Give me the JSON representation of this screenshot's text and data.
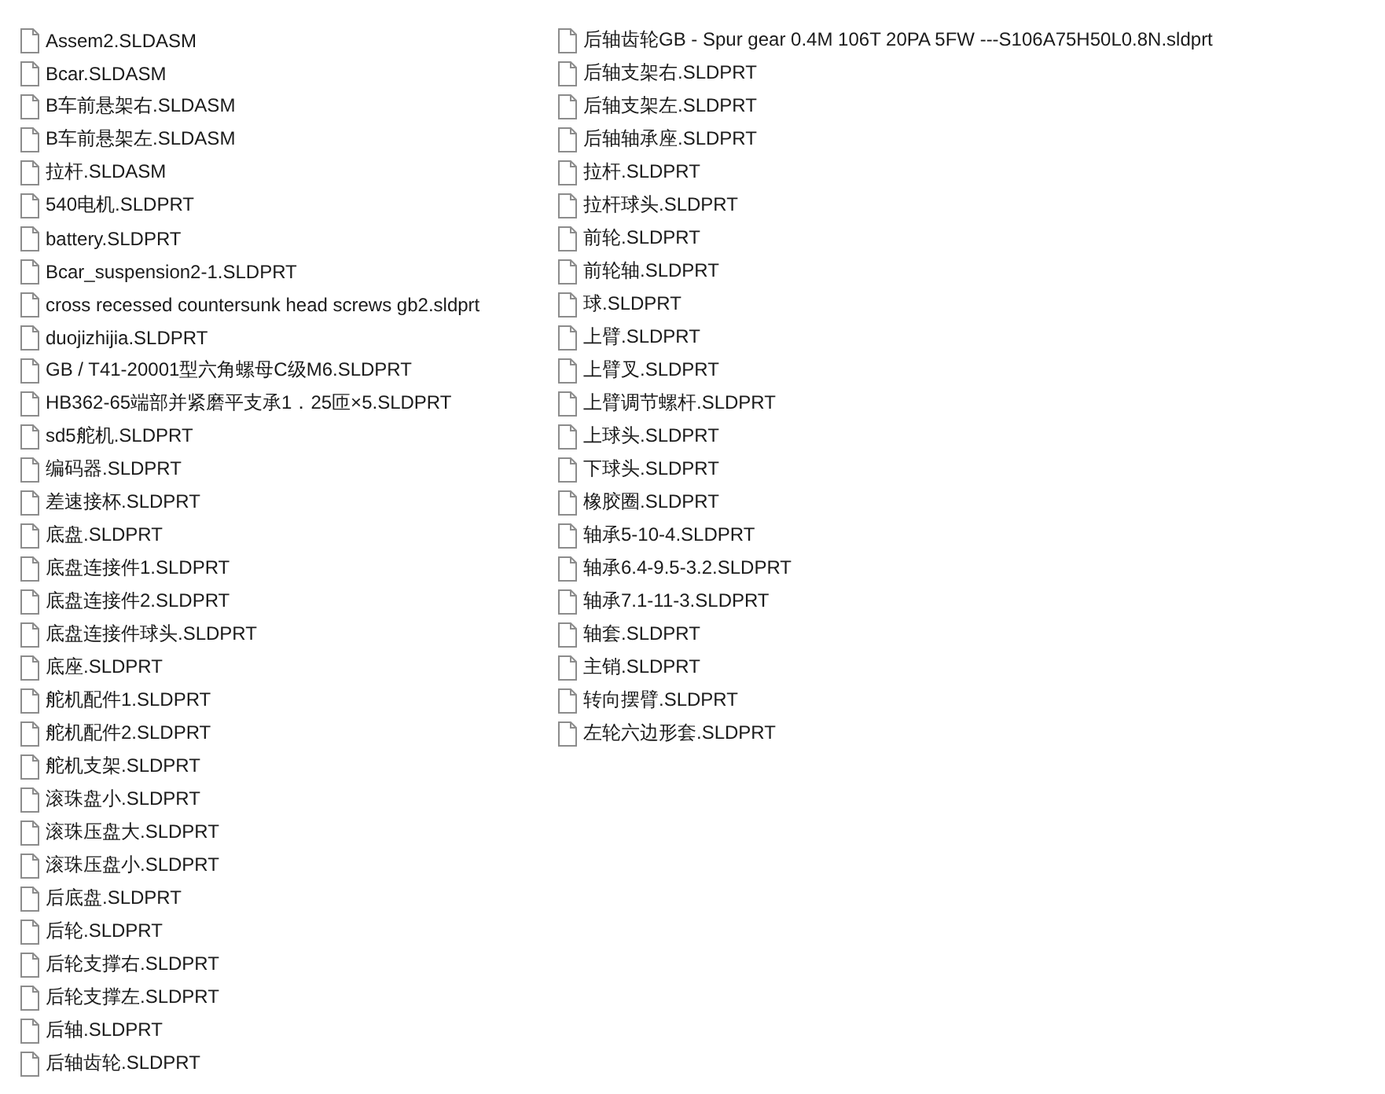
{
  "files": [
    {
      "name": "Assem2.SLDASM"
    },
    {
      "name": "Bcar.SLDASM"
    },
    {
      "name": "B车前悬架右.SLDASM"
    },
    {
      "name": "B车前悬架左.SLDASM"
    },
    {
      "name": "拉杆.SLDASM"
    },
    {
      "name": "540电机.SLDPRT"
    },
    {
      "name": "battery.SLDPRT"
    },
    {
      "name": "Bcar_suspension2-1.SLDPRT"
    },
    {
      "name": "cross recessed countersunk head screws gb2.sldprt"
    },
    {
      "name": "duojizhijia.SLDPRT"
    },
    {
      "name": "GB / T41-20001型六角螺母C级M6.SLDPRT"
    },
    {
      "name": "HB362-65端部并紧磨平支承1．25匝×5.SLDPRT"
    },
    {
      "name": "sd5舵机.SLDPRT"
    },
    {
      "name": "编码器.SLDPRT"
    },
    {
      "name": "差速接杯.SLDPRT"
    },
    {
      "name": "底盘.SLDPRT"
    },
    {
      "name": "底盘连接件1.SLDPRT"
    },
    {
      "name": "底盘连接件2.SLDPRT"
    },
    {
      "name": "底盘连接件球头.SLDPRT"
    },
    {
      "name": "底座.SLDPRT"
    },
    {
      "name": "舵机配件1.SLDPRT"
    },
    {
      "name": "舵机配件2.SLDPRT"
    },
    {
      "name": "舵机支架.SLDPRT"
    },
    {
      "name": "滚珠盘小.SLDPRT"
    },
    {
      "name": "滚珠压盘大.SLDPRT"
    },
    {
      "name": "滚珠压盘小.SLDPRT"
    },
    {
      "name": "后底盘.SLDPRT"
    },
    {
      "name": "后轮.SLDPRT"
    },
    {
      "name": "后轮支撑右.SLDPRT"
    },
    {
      "name": "后轮支撑左.SLDPRT"
    },
    {
      "name": "后轴.SLDPRT"
    },
    {
      "name": "后轴齿轮.SLDPRT"
    },
    {
      "name": "后轴齿轮GB - Spur gear 0.4M 106T 20PA 5FW ---S106A75H50L0.8N.sldprt"
    },
    {
      "name": "后轴支架右.SLDPRT"
    },
    {
      "name": "后轴支架左.SLDPRT"
    },
    {
      "name": "后轴轴承座.SLDPRT"
    },
    {
      "name": "拉杆.SLDPRT"
    },
    {
      "name": "拉杆球头.SLDPRT"
    },
    {
      "name": "前轮.SLDPRT"
    },
    {
      "name": "前轮轴.SLDPRT"
    },
    {
      "name": "球.SLDPRT"
    },
    {
      "name": "上臂.SLDPRT"
    },
    {
      "name": "上臂叉.SLDPRT"
    },
    {
      "name": "上臂调节螺杆.SLDPRT"
    },
    {
      "name": "上球头.SLDPRT"
    },
    {
      "name": "下球头.SLDPRT"
    },
    {
      "name": "橡胶圈.SLDPRT"
    },
    {
      "name": "轴承5-10-4.SLDPRT"
    },
    {
      "name": "轴承6.4-9.5-3.2.SLDPRT"
    },
    {
      "name": "轴承7.1-11-3.SLDPRT"
    },
    {
      "name": "轴套.SLDPRT"
    },
    {
      "name": "主销.SLDPRT"
    },
    {
      "name": "转向摆臂.SLDPRT"
    },
    {
      "name": "左轮六边形套.SLDPRT"
    }
  ]
}
